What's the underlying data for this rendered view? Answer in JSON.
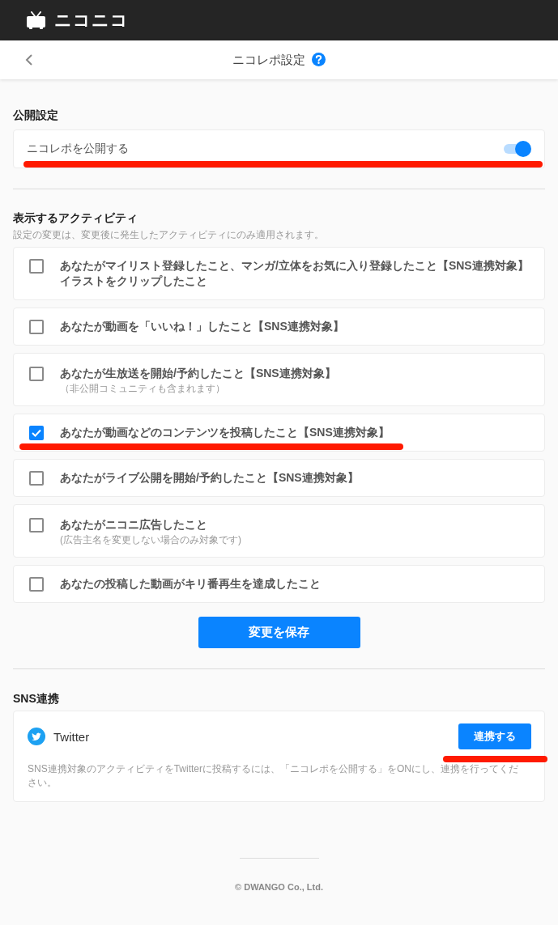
{
  "header": {
    "logo": "ニコニコ"
  },
  "nav": {
    "title": "ニコレポ設定"
  },
  "publish_section": {
    "heading": "公開設定",
    "label": "ニコレポを公開する",
    "on": true,
    "marked": true
  },
  "activity_section": {
    "heading": "表示するアクティビティ",
    "note": "設定の変更は、変更後に発生したアクティビティにのみ適用されます。",
    "items": [
      {
        "label": "あなたがマイリスト登録したこと、マンガ/立体をお気に入り登録したこと【SNS連携対象】イラストをクリップしたこと",
        "checked": false,
        "marked": false
      },
      {
        "label": "あなたが動画を「いいね！」したこと【SNS連携対象】",
        "checked": false,
        "marked": false
      },
      {
        "label": "あなたが生放送を開始/予約したこと【SNS連携対象】",
        "sub": "（非公開コミュニティも含まれます）",
        "checked": false,
        "marked": false
      },
      {
        "label": "あなたが動画などのコンテンツを投稿したこと【SNS連携対象】",
        "checked": true,
        "marked": true
      },
      {
        "label": "あなたがライブ公開を開始/予約したこと【SNS連携対象】",
        "checked": false,
        "marked": false
      },
      {
        "label": "あなたがニコニ広告したこと",
        "sub": "(広告主名を変更しない場合のみ対象です)",
        "checked": false,
        "marked": false
      },
      {
        "label": "あなたの投稿した動画がキリ番再生を達成したこと",
        "checked": false,
        "marked": false
      }
    ],
    "save_button": "変更を保存"
  },
  "sns_section": {
    "heading": "SNS連携",
    "services": [
      {
        "name": "Twitter",
        "button": "連携する",
        "marked": true,
        "description": "SNS連携対象のアクティビティをTwitterに投稿するには、「ニコレポを公開する」をONにし、連携を行ってください。"
      }
    ]
  },
  "footer": {
    "copyright": "© DWANGO Co., Ltd."
  }
}
